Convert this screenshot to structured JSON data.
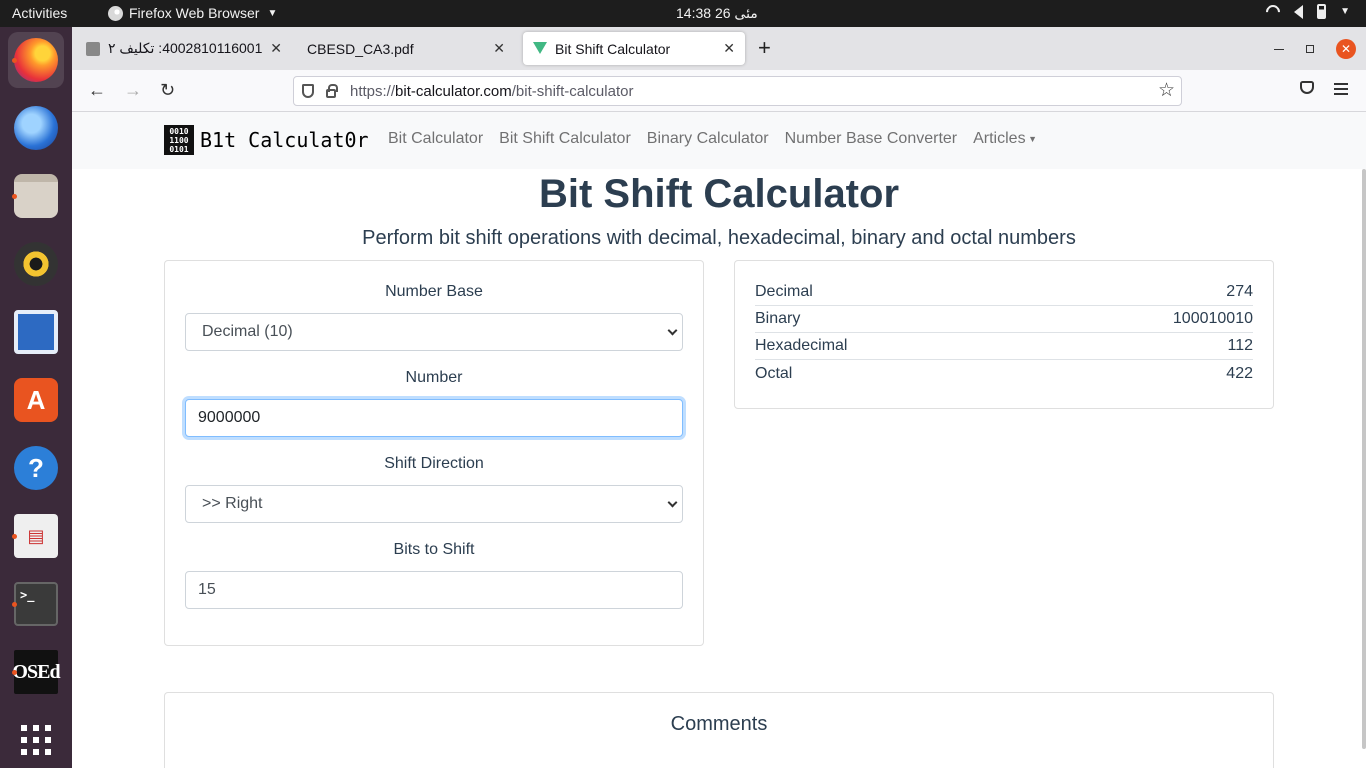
{
  "topbar": {
    "activities": "Activities",
    "app_name": "Firefox Web Browser",
    "clock": "14:38 مئی 26"
  },
  "dock": {
    "items": [
      "firefox",
      "thunderbird",
      "files",
      "rhythmbox",
      "libreoffice-writer",
      "software",
      "help",
      "document-viewer",
      "terminal",
      "osed",
      "show-applications"
    ],
    "terminal_glyph": ">_",
    "osed_label": "OSEd",
    "help_glyph": "?",
    "store_glyph": "A"
  },
  "browser": {
    "tabs": [
      {
        "title": "4002810116001: تکلیف ۲"
      },
      {
        "title": "CBESD_CA3.pdf"
      },
      {
        "title": "Bit Shift Calculator"
      }
    ],
    "url": {
      "protocol": "https://",
      "host": "bit-calculator.com",
      "path": "/bit-shift-calculator"
    }
  },
  "site": {
    "brand_logo": [
      "0010",
      "1100",
      "0101"
    ],
    "brand_text": "B1t Calculat0r",
    "nav": [
      "Bit Calculator",
      "Bit Shift Calculator",
      "Binary Calculator",
      "Number Base Converter",
      "Articles"
    ],
    "title": "Bit Shift Calculator",
    "lead": "Perform bit shift operations with decimal, hexadecimal, binary and octal numbers"
  },
  "form": {
    "number_base_label": "Number Base",
    "number_base_value": "Decimal (10)",
    "number_label": "Number",
    "number_value": "9000000",
    "direction_label": "Shift Direction",
    "direction_value": ">> Right",
    "bits_label": "Bits to Shift",
    "bits_value": "15"
  },
  "results": [
    {
      "label": "Decimal",
      "value": "274"
    },
    {
      "label": "Binary",
      "value": "100010010"
    },
    {
      "label": "Hexadecimal",
      "value": "112"
    },
    {
      "label": "Octal",
      "value": "422"
    }
  ],
  "comments": {
    "title": "Comments"
  },
  "colors": {
    "accent": "#e95420",
    "heading": "#2c3e50",
    "focus_ring": "#80bdff"
  }
}
